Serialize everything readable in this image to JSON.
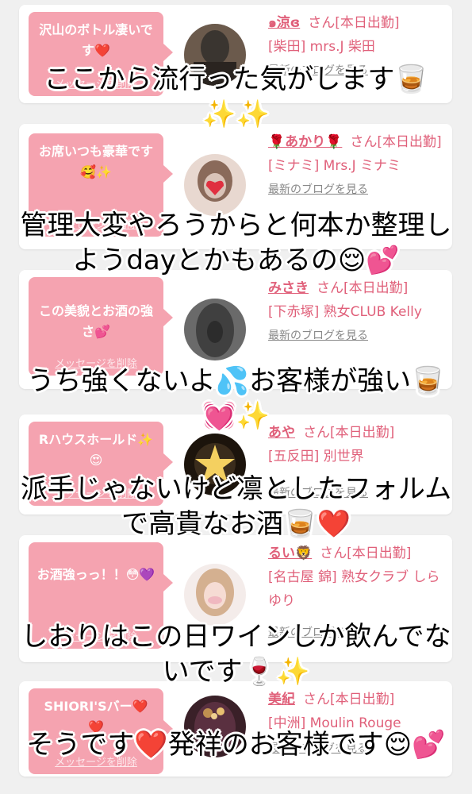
{
  "cards": [
    {
      "message": "沢山のボトル凄いです❤️",
      "delete_label": "メッセージを削除",
      "name": "๑涼ɞ",
      "san": "さん[本日出勤]",
      "shop": "[柴田] mrs.J 柴田",
      "blog": "最新のブログを見る",
      "avatar_colors": [
        "#3a3530",
        "#6b5a4c",
        "#2a2420"
      ]
    },
    {
      "message": "お席いつも豪華です🥰✨",
      "delete_label": "メッセージを削除",
      "name": "🌹あかり🌹",
      "san": "さん[本日出勤]",
      "shop": "[ミナミ] Mrs.J ミナミ",
      "blog": "最新のブログを見る",
      "avatar_colors": [
        "#d9c3b8",
        "#8a6a5a",
        "#e8d8d0"
      ]
    },
    {
      "message": "この美貌とお酒の強さ💕",
      "delete_label": "メッセージを削除",
      "name": "みさき",
      "san": "さん[本日出勤]",
      "shop": "[下赤塚] 熟女CLUB Kelly",
      "blog": "最新のブログを見る",
      "avatar_colors": [
        "#404040",
        "#6a6a6a",
        "#2c2c2c"
      ]
    },
    {
      "message": "Rハウスホールド✨😍",
      "delete_label": "メッセージを削除",
      "name": "あや",
      "san": "さん[本日出勤]",
      "shop": "[五反田] 別世界",
      "blog": "最新のブログを見る",
      "avatar_colors": [
        "#3a2c1c",
        "#b08040",
        "#1c140c"
      ]
    },
    {
      "message": "お酒強っっ！！😳💜",
      "delete_label": "メッセージを削除",
      "name": "るい🦁",
      "san": "さん[本日出勤]",
      "shop": "[名古屋 錦] 熟女クラブ しらゆり",
      "blog": "最新のブログを見る",
      "avatar_colors": [
        "#e8e0dc",
        "#d4b090",
        "#f4ecea"
      ]
    },
    {
      "message": "SHIORI'Sバー❤️❤️",
      "delete_label": "メッセージを削除",
      "name": "美紀",
      "san": "さん[本日出勤]",
      "shop": "[中洲] Moulin Rouge",
      "blog": "最新のブログを見る",
      "avatar_colors": [
        "#5a3040",
        "#c09050",
        "#3a2028"
      ]
    }
  ],
  "overlays": [
    "ここから流行った気がします🥃✨✨",
    "管理大変やろうからと何本か整理しようdayとかもあるの😌💕",
    "うち強くないよ💦お客様が強い🥃💓✨",
    "派手じゃないけど凛としたフォルムで高貴なお酒🥃❤️",
    "しおりはこの日ワインしか飲んでないです🍷✨",
    "そうです❤️発祥のお客様です😌💕"
  ]
}
